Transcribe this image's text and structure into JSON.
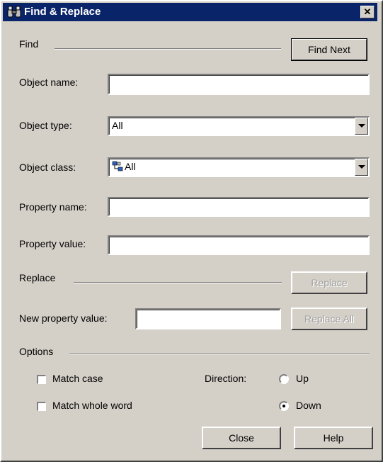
{
  "window": {
    "title": "Find & Replace",
    "close_glyph": "✕",
    "title_icon": "binoculars-icon"
  },
  "find": {
    "section_label": "Find",
    "find_next_label": "Find Next",
    "object_name_label": "Object name:",
    "object_name_value": "",
    "object_type_label": "Object type:",
    "object_type_value": "All",
    "object_class_label": "Object class:",
    "object_class_value": "All",
    "object_class_icon": "objects-icon",
    "property_name_label": "Property name:",
    "property_name_value": "",
    "property_value_label": "Property value:",
    "property_value_value": ""
  },
  "replace": {
    "section_label": "Replace",
    "replace_label": "Replace",
    "new_property_value_label": "New property value:",
    "new_property_value_value": "",
    "replace_all_label": "Replace All"
  },
  "options": {
    "section_label": "Options",
    "match_case_label": "Match case",
    "match_case_checked": false,
    "match_whole_word_label": "Match whole word",
    "match_whole_word_checked": false,
    "direction_label": "Direction:",
    "up_label": "Up",
    "down_label": "Down",
    "direction_selected": "Down"
  },
  "footer": {
    "close_label": "Close",
    "help_label": "Help"
  },
  "colors": {
    "titlebar": "#0a246a",
    "face": "#d4d0c8"
  }
}
